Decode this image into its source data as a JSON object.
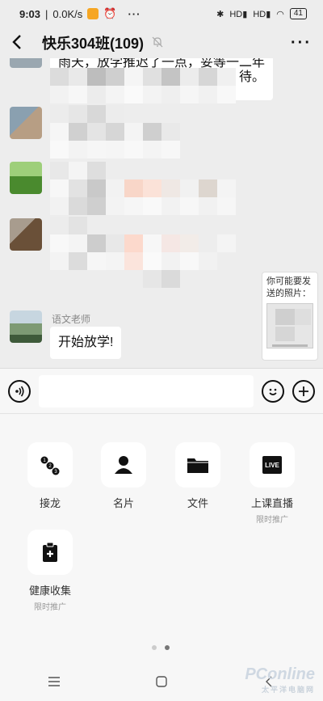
{
  "status_bar": {
    "time": "9:03",
    "speed": "0.0K/s",
    "more": "···",
    "battery": "41",
    "signal1": "HD",
    "signal2": "HD"
  },
  "header": {
    "title": "快乐304班(109)",
    "more": "···"
  },
  "messages": {
    "partial_text": "雨天，放学推迟了一点，妥等一二年",
    "partial_text_end": "待。",
    "last_sender": "语文老师",
    "last_text": "开始放学!"
  },
  "photo_suggest": {
    "text": "你可能要发送的照片："
  },
  "input": {
    "value": "",
    "placeholder": ""
  },
  "tools": [
    {
      "label": "接龙",
      "sub": ""
    },
    {
      "label": "名片",
      "sub": ""
    },
    {
      "label": "文件",
      "sub": ""
    },
    {
      "label": "上课直播",
      "sub": "限时推广",
      "badge": "LIVE"
    },
    {
      "label": "健康收集",
      "sub": "限时推广"
    }
  ],
  "watermark": {
    "brand": "PConline",
    "tagline": "太平洋电脑网"
  }
}
